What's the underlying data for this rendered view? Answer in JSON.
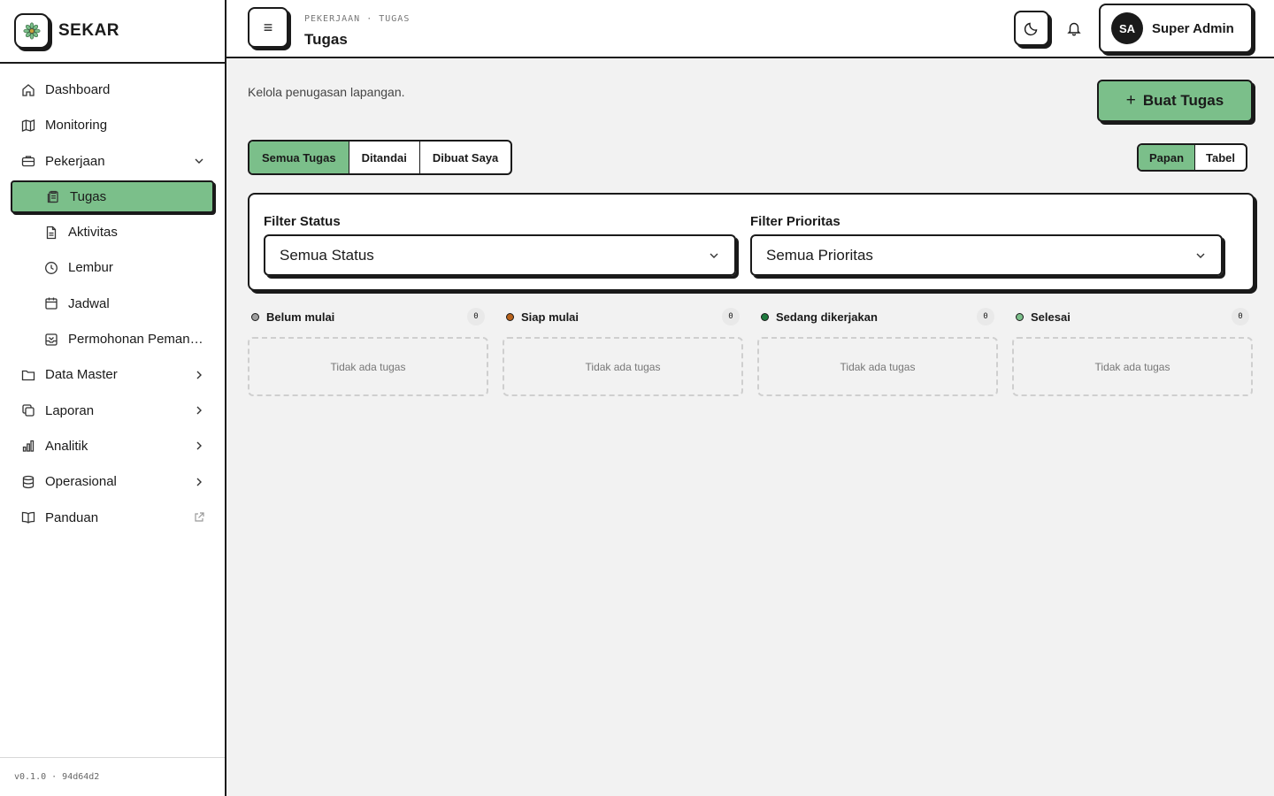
{
  "brand": {
    "name": "SEKAR"
  },
  "sidebar": {
    "items": [
      {
        "label": "Dashboard",
        "icon": "home-icon"
      },
      {
        "label": "Monitoring",
        "icon": "map-icon"
      },
      {
        "label": "Pekerjaan",
        "icon": "briefcase-icon",
        "expanded": true
      },
      {
        "label": "Tugas",
        "icon": "clipboard-icon",
        "active": true
      },
      {
        "label": "Aktivitas",
        "icon": "file-icon"
      },
      {
        "label": "Lembur",
        "icon": "clock-icon"
      },
      {
        "label": "Jadwal",
        "icon": "calendar-icon"
      },
      {
        "label": "Permohonan Pemang...",
        "icon": "inbox-icon"
      },
      {
        "label": "Data Master",
        "icon": "folder-icon"
      },
      {
        "label": "Laporan",
        "icon": "copy-icon"
      },
      {
        "label": "Analitik",
        "icon": "bar-chart-icon"
      },
      {
        "label": "Operasional",
        "icon": "database-icon"
      },
      {
        "label": "Panduan",
        "icon": "book-icon"
      }
    ],
    "version": "v0.1.0 · 94d64d2"
  },
  "header": {
    "breadcrumb": "PEKERJAAN · TUGAS",
    "title": "Tugas",
    "user": {
      "initials": "SA",
      "name": "Super Admin"
    }
  },
  "main": {
    "subtitle": "Kelola penugasan lapangan.",
    "create_button": "Buat Tugas",
    "tabs": [
      "Semua Tugas",
      "Ditandai",
      "Dibuat Saya"
    ],
    "view_options": [
      "Papan",
      "Tabel"
    ],
    "filters": {
      "status_label": "Filter Status",
      "status_value": "Semua Status",
      "priority_label": "Filter Prioritas",
      "priority_value": "Semua Prioritas"
    },
    "columns": [
      {
        "title": "Belum mulai",
        "count": "0",
        "color": "#9e9e9e",
        "empty": "Tidak ada tugas"
      },
      {
        "title": "Siap mulai",
        "count": "0",
        "color": "#b8621b",
        "empty": "Tidak ada tugas"
      },
      {
        "title": "Sedang dikerjakan",
        "count": "0",
        "color": "#1f7a3e",
        "empty": "Tidak ada tugas"
      },
      {
        "title": "Selesai",
        "count": "0",
        "color": "#7bbf8a",
        "empty": "Tidak ada tugas"
      }
    ]
  },
  "colors": {
    "accent": "#7bbf8a",
    "ink": "#1a1a1a",
    "background": "#f2f2f2"
  }
}
